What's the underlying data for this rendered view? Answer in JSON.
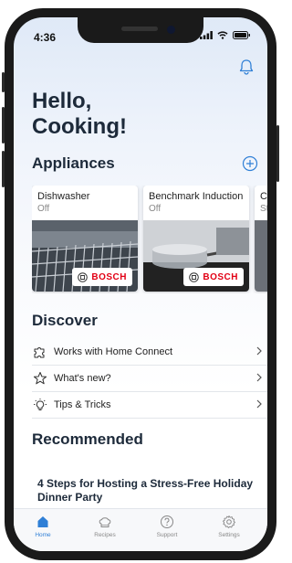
{
  "status_bar": {
    "time": "4:36"
  },
  "header": {
    "greeting": "Hello,\nCooking!"
  },
  "appliances": {
    "title": "Appliances",
    "items": [
      {
        "name": "Dishwasher",
        "status": "Off",
        "brand": "BOSCH"
      },
      {
        "name": "Benchmark Induction",
        "status": "Off",
        "brand": "BOSCH"
      },
      {
        "name": "Co",
        "status": "St"
      }
    ]
  },
  "discover": {
    "title": "Discover",
    "items": [
      {
        "label": "Works with Home Connect",
        "icon": "puzzle-icon"
      },
      {
        "label": "What's new?",
        "icon": "star-icon"
      },
      {
        "label": "Tips & Tricks",
        "icon": "lightbulb-icon"
      }
    ]
  },
  "recommended": {
    "title": "Recommended",
    "card_title": "4 Steps for Hosting a Stress-Free Holiday Dinner Party"
  },
  "tabbar": {
    "items": [
      {
        "label": "Home",
        "icon": "home-icon",
        "active": true
      },
      {
        "label": "Recipes",
        "icon": "chef-hat-icon"
      },
      {
        "label": "Support",
        "icon": "question-icon"
      },
      {
        "label": "Settings",
        "icon": "gear-icon"
      }
    ]
  },
  "colors": {
    "accent": "#2f7fd6",
    "brand": "#e20015",
    "heading": "#1d2a3a"
  }
}
